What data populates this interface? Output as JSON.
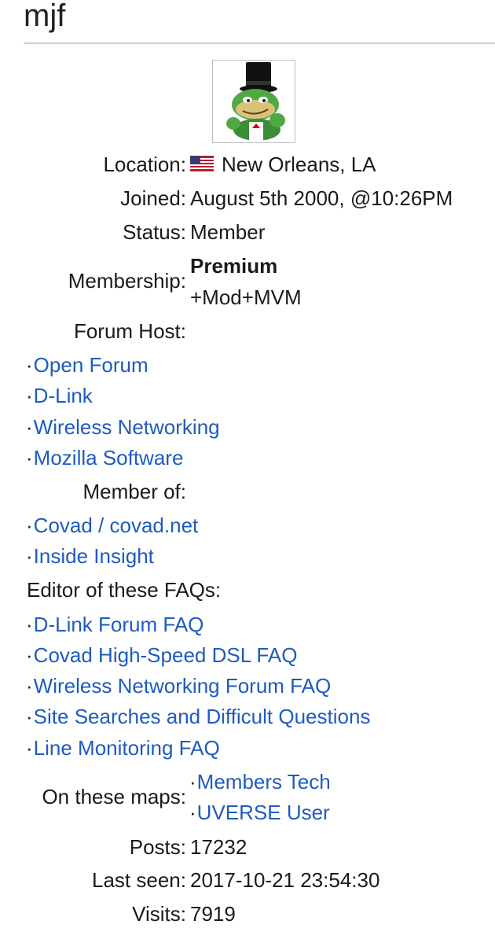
{
  "user": {
    "name": "mjf"
  },
  "avatar": {
    "icon": "frog-in-top-hat-avatar"
  },
  "profile": {
    "location_label": "Location:",
    "location_value": "New Orleans, LA",
    "location_flag": "us-flag-icon",
    "joined_label": "Joined:",
    "joined_value": "August 5th 2000, @10:26PM",
    "status_label": "Status:",
    "status_value": "Member",
    "membership_label": "Membership:",
    "membership_tier": "Premium",
    "membership_extra": "+Mod+MVM",
    "forum_host_label": "Forum Host:",
    "forum_host_links": [
      "Open Forum",
      "D-Link",
      "Wireless Networking",
      "Mozilla Software"
    ],
    "member_of_label": "Member of:",
    "member_of_links": [
      "Covad / covad.net",
      "Inside Insight"
    ],
    "faq_editor_label": "Editor of these FAQs:",
    "faq_links": [
      "D-Link Forum FAQ",
      "Covad High-Speed DSL FAQ",
      "Wireless Networking Forum FAQ",
      "Site Searches and Difficult Questions",
      "Line Monitoring FAQ"
    ],
    "maps_label": "On these maps:",
    "maps_links": [
      "Members Tech",
      "UVERSE User"
    ],
    "posts_label": "Posts:",
    "posts_value": "17232",
    "last_seen_label": "Last seen:",
    "last_seen_value": "2017-10-21 23:54:30",
    "visits_label": "Visits:",
    "visits_value": "7919"
  },
  "colors": {
    "link": "#1f5bbf",
    "text": "#1a1a1a",
    "rule": "#cfcfcf"
  }
}
